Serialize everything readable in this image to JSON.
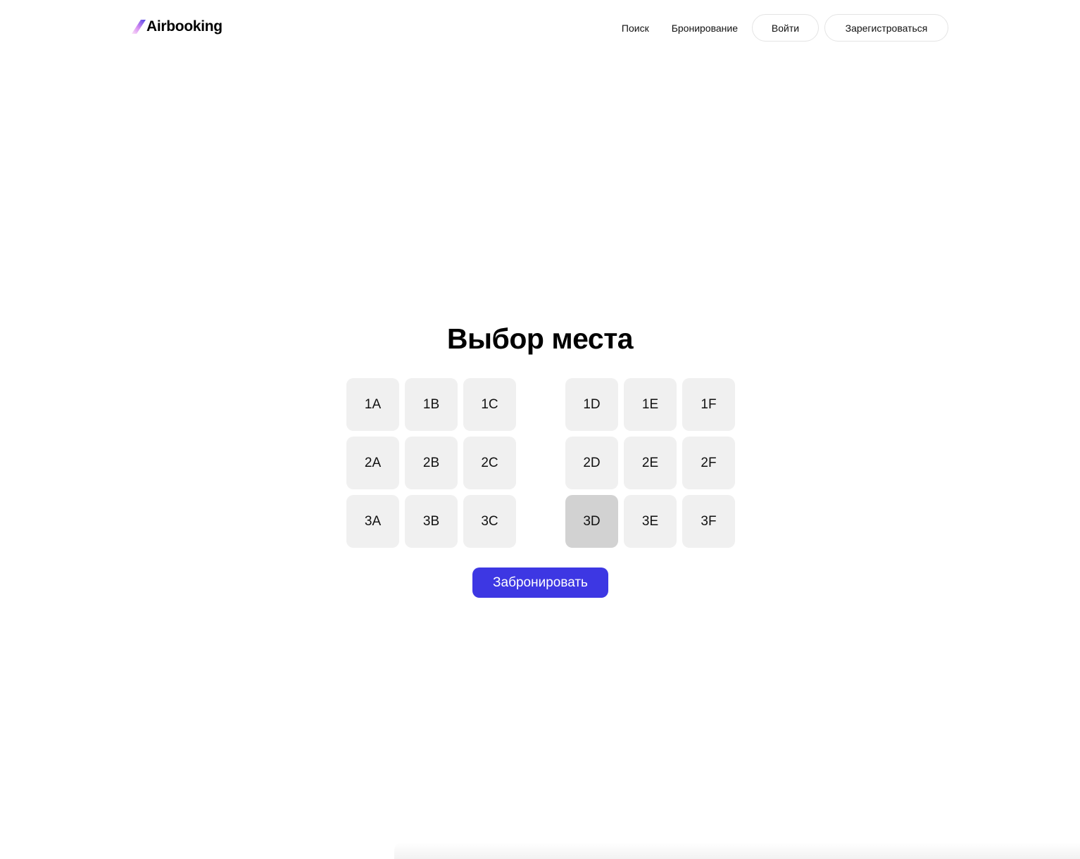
{
  "header": {
    "logo_text": "Airbooking",
    "logo_icon": "slash-gradient-logo-icon",
    "nav": {
      "search_label": "Поиск",
      "booking_label": "Бронирование",
      "login_label": "Войти",
      "register_label": "Зарегистроваться"
    }
  },
  "main": {
    "title": "Выбор места",
    "seats": {
      "left": [
        {
          "label": "1A",
          "selected": false
        },
        {
          "label": "1B",
          "selected": false
        },
        {
          "label": "1C",
          "selected": false
        },
        {
          "label": "2A",
          "selected": false
        },
        {
          "label": "2B",
          "selected": false
        },
        {
          "label": "2C",
          "selected": false
        },
        {
          "label": "3A",
          "selected": false
        },
        {
          "label": "3B",
          "selected": false
        },
        {
          "label": "3C",
          "selected": false
        }
      ],
      "right": [
        {
          "label": "1D",
          "selected": false
        },
        {
          "label": "1E",
          "selected": false
        },
        {
          "label": "1F",
          "selected": false
        },
        {
          "label": "2D",
          "selected": false
        },
        {
          "label": "2E",
          "selected": false
        },
        {
          "label": "2F",
          "selected": false
        },
        {
          "label": "3D",
          "selected": true
        },
        {
          "label": "3E",
          "selected": false
        },
        {
          "label": "3F",
          "selected": false
        }
      ]
    },
    "book_button_label": "Забронировать"
  },
  "colors": {
    "accent": "#3d37e3",
    "seat_default": "#f0f0f0",
    "seat_selected": "#d2d2d2",
    "logo_gradient": [
      "#f7b6f0",
      "#a855f7",
      "#4f46e5"
    ]
  }
}
